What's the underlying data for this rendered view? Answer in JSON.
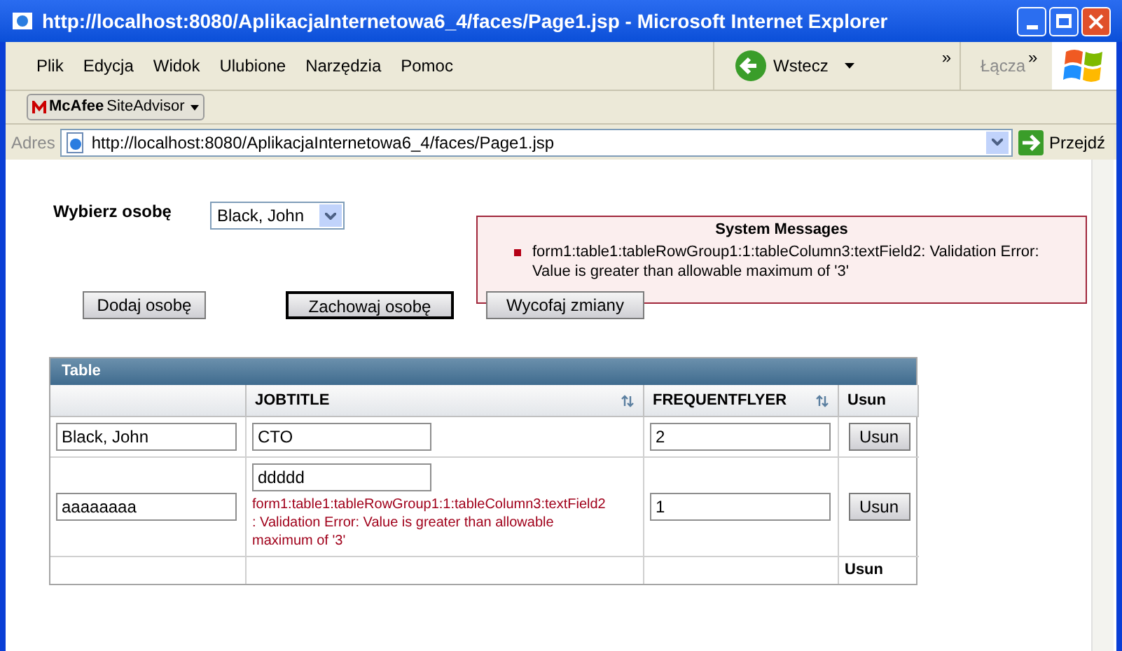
{
  "window": {
    "title": "http://localhost:8080/AplikacjaInternetowa6_4/faces/Page1.jsp - Microsoft Internet Explorer"
  },
  "menu": [
    "Plik",
    "Edycja",
    "Widok",
    "Ulubione",
    "Narzędzia",
    "Pomoc"
  ],
  "toolbar": {
    "back": "Wstecz",
    "chevron": "»",
    "links": "Łącza",
    "links_chevron": "»"
  },
  "siteadvisor": {
    "brand": "McAfee",
    "label": "SiteAdvisor"
  },
  "address_bar": {
    "label": "Adres",
    "url": "http://localhost:8080/AplikacjaInternetowa6_4/faces/Page1.jsp",
    "go": "Przejdź"
  },
  "page": {
    "person_label": "Wybierz osobę",
    "person_select": "Black, John",
    "messages": {
      "title": "System Messages",
      "items": [
        "form1:table1:tableRowGroup1:1:tableColumn3:textField2: Validation Error: Value is greater than allowable maximum of '3'"
      ]
    },
    "buttons": [
      {
        "label": "Dodaj osobę",
        "focused": false
      },
      {
        "label": "Zachowaj osobę",
        "focused": true
      },
      {
        "label": "Wycofaj zmiany",
        "focused": false
      }
    ],
    "table": {
      "title": "Table",
      "columns": [
        {
          "sortable": false
        },
        {
          "label": "JOBTITLE",
          "sortable": true
        },
        {
          "label": "FREQUENTFLYER",
          "sortable": true
        },
        {
          "label": "Usun",
          "sortable": false
        }
      ],
      "rows": [
        {
          "name": "Black, John",
          "jobtitle": "CTO",
          "frequentflyer": "2",
          "action": "Usun"
        },
        {
          "name": "aaaaaaaa",
          "jobtitle": "ddddd",
          "error": "form1:table1:tableRowGroup1:1:tableColumn3:textField2: Validation Error: Value is greater than allowable maximum of '3'",
          "frequentflyer": "1",
          "action": "Usun"
        }
      ],
      "footer": "Usun"
    }
  }
}
